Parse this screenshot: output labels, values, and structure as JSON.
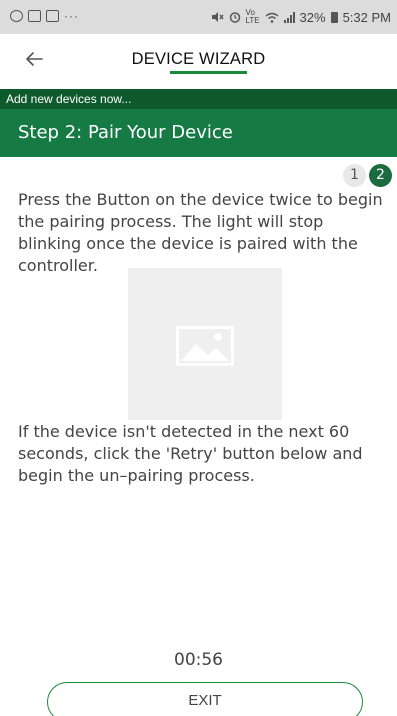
{
  "status_bar": {
    "dots": "···",
    "network": "Vo LTE",
    "battery_percent": "32%",
    "time": "5:32 PM"
  },
  "header": {
    "title": "DEVICE WIZARD",
    "back_icon": "arrow-left-icon"
  },
  "banner": {
    "subtitle": "Add new devices now...",
    "step_title": "Step 2: Pair Your Device"
  },
  "steps": [
    {
      "label": "1",
      "active": false
    },
    {
      "label": "2",
      "active": true
    }
  ],
  "content": {
    "instructions": "Press the Button on the device twice to begin the pairing process. The light will stop blinking once the device is paired with the controller.",
    "image_icon": "image-placeholder-icon",
    "retry_text": "If the device isn't detected in the next 60 seconds, click the 'Retry' button below and begin the un–pairing process."
  },
  "timer": "00:56",
  "exit_label": "EXIT",
  "colors": {
    "header_accent": "#1a8a3a",
    "subtitle_bg": "#0e5a2c",
    "step_bg": "#167a44",
    "active_step": "#1b6b3e"
  }
}
